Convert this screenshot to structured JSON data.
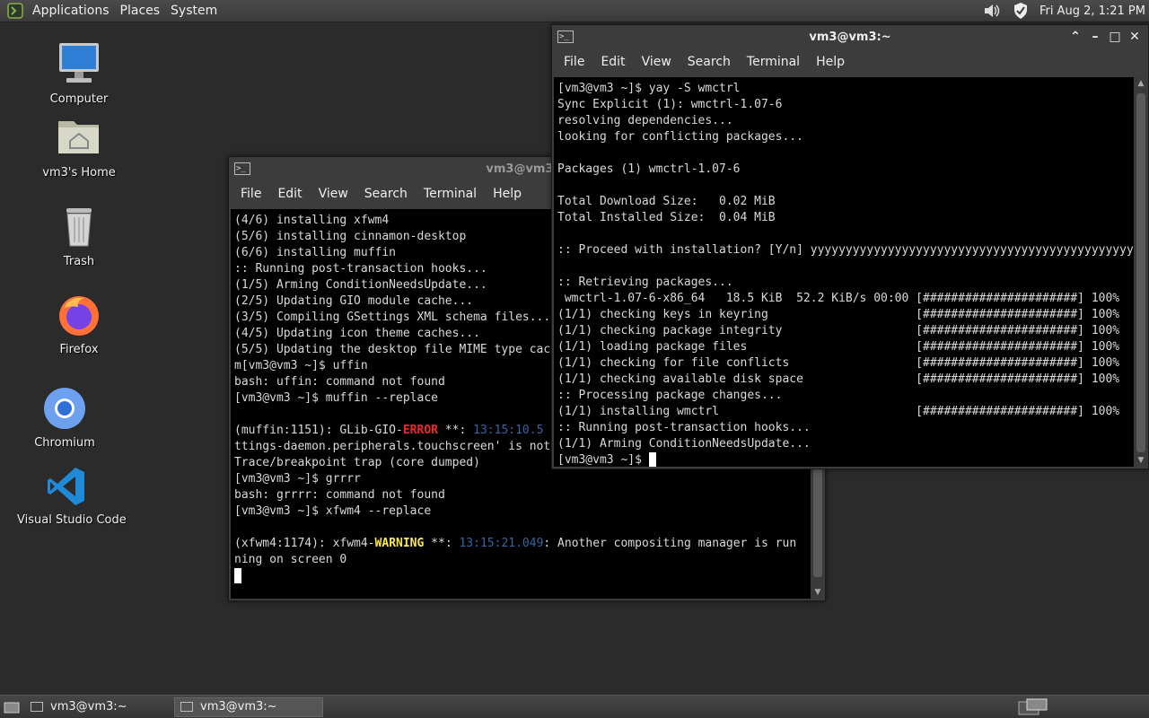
{
  "top_panel": {
    "menus": [
      "Applications",
      "Places",
      "System"
    ],
    "clock": "Fri Aug  2, 1:21 PM"
  },
  "desktop_icons": [
    {
      "label": "Computer",
      "icon": "computer-icon"
    },
    {
      "label": "vm3's Home",
      "icon": "home-folder-icon"
    },
    {
      "label": "Trash",
      "icon": "trash-icon"
    },
    {
      "label": "Firefox",
      "icon": "firefox-icon"
    },
    {
      "label": "Chromium",
      "icon": "chromium-icon"
    },
    {
      "label": "Visual Studio Code",
      "icon": "vscode-icon"
    }
  ],
  "term_back": {
    "title": "vm3@vm3:~",
    "menu": [
      "File",
      "Edit",
      "View",
      "Search",
      "Terminal",
      "Help"
    ],
    "lines": [
      "(4/6) installing xfwm4",
      "(5/6) installing cinnamon-desktop",
      "(6/6) installing muffin",
      ":: Running post-transaction hooks...",
      "(1/5) Arming ConditionNeedsUpdate...",
      "(2/5) Updating GIO module cache...",
      "(3/5) Compiling GSettings XML schema files...",
      "(4/5) Updating icon theme caches...",
      "(5/5) Updating the desktop file MIME type cache...",
      "m[vm3@vm3 ~]$ uffin",
      "bash: uffin: command not found",
      "[vm3@vm3 ~]$ muffin --replace",
      "",
      "__ERR__",
      "ttings-daemon.peripherals.touchscreen' is not installed",
      "Trace/breakpoint trap (core dumped)",
      "[vm3@vm3 ~]$ grrrr",
      "bash: grrrr: command not found",
      "[vm3@vm3 ~]$ xfwm4 --replace",
      "",
      "__WARN__",
      "ning on screen 0"
    ],
    "error_line": {
      "pre": "(muffin:1151): GLib-GIO-",
      "tag": "ERROR",
      "mid": " **: ",
      "time": "13:15:10.5",
      "post": ""
    },
    "warn_line": {
      "pre": "(xfwm4:1174): xfwm4-",
      "tag": "WARNING",
      "mid": " **: ",
      "time": "13:15:21.049",
      "post": ": Another compositing manager is run"
    }
  },
  "term_front": {
    "title": "vm3@vm3:~",
    "menu": [
      "File",
      "Edit",
      "View",
      "Search",
      "Terminal",
      "Help"
    ],
    "lines": [
      "[vm3@vm3 ~]$ yay -S wmctrl",
      "Sync Explicit (1): wmctrl-1.07-6",
      "resolving dependencies...",
      "looking for conflicting packages...",
      "",
      "Packages (1) wmctrl-1.07-6",
      "",
      "Total Download Size:   0.02 MiB",
      "Total Installed Size:  0.04 MiB",
      "",
      ":: Proceed with installation? [Y/n] yyyyyyyyyyyyyyyyyyyyyyyyyyyyyyyyyyyyyyyyyyyyyyy",
      "",
      ":: Retrieving packages...",
      " wmctrl-1.07-6-x86_64   18.5 KiB  52.2 KiB/s 00:00 [######################] 100%",
      "(1/1) checking keys in keyring                     [######################] 100%",
      "(1/1) checking package integrity                   [######################] 100%",
      "(1/1) loading package files                        [######################] 100%",
      "(1/1) checking for file conflicts                  [######################] 100%",
      "(1/1) checking available disk space                [######################] 100%",
      ":: Processing package changes...",
      "(1/1) installing wmctrl                            [######################] 100%",
      ":: Running post-transaction hooks...",
      "(1/1) Arming ConditionNeedsUpdate...",
      "[vm3@vm3 ~]$ "
    ]
  },
  "taskbar": {
    "items": [
      {
        "label": "vm3@vm3:~",
        "active": false
      },
      {
        "label": "vm3@vm3:~",
        "active": true
      }
    ]
  }
}
